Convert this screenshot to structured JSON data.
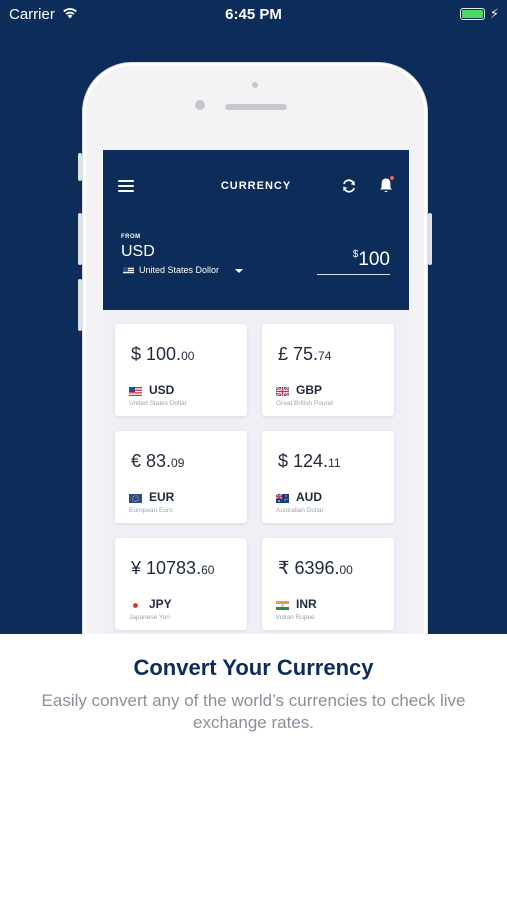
{
  "status_bar": {
    "carrier": "Carrier",
    "time": "6:45 PM"
  },
  "app": {
    "title": "CURRENCY",
    "from": {
      "label": "FROM",
      "code": "USD",
      "name": "United States Dollor",
      "amount_symbol": "$",
      "amount_value": "100"
    }
  },
  "cards": [
    {
      "symbol": "$",
      "whole": " 100.",
      "decimal": "00",
      "code": "USD",
      "name": "United States Dollar",
      "flag": "us-flag"
    },
    {
      "symbol": "£",
      "whole": " 75.",
      "decimal": "74",
      "code": "GBP",
      "name": "Great British Pound",
      "flag": "uk-flag"
    },
    {
      "symbol": "€",
      "whole": " 83.",
      "decimal": "09",
      "code": "EUR",
      "name": "European Euro",
      "flag": "eu-flag"
    },
    {
      "symbol": "$",
      "whole": " 124.",
      "decimal": "11",
      "code": "AUD",
      "name": "Australian Dollar",
      "flag": "au-flag"
    },
    {
      "symbol": "¥",
      "whole": " 10783.",
      "decimal": "60",
      "code": "JPY",
      "name": "Japanese Yen",
      "flag": "jp-flag"
    },
    {
      "symbol": "₹",
      "whole": " 6396.",
      "decimal": "00",
      "code": "INR",
      "name": "Indian Rupee",
      "flag": "in-flag"
    }
  ],
  "caption": {
    "title": "Convert Your Currency",
    "body": "Easily convert any of the world’s currencies to check live exchange rates."
  },
  "colors": {
    "navy": "#0c2c5a",
    "battery": "#4cd964",
    "muted_text": "#8a8f99"
  }
}
